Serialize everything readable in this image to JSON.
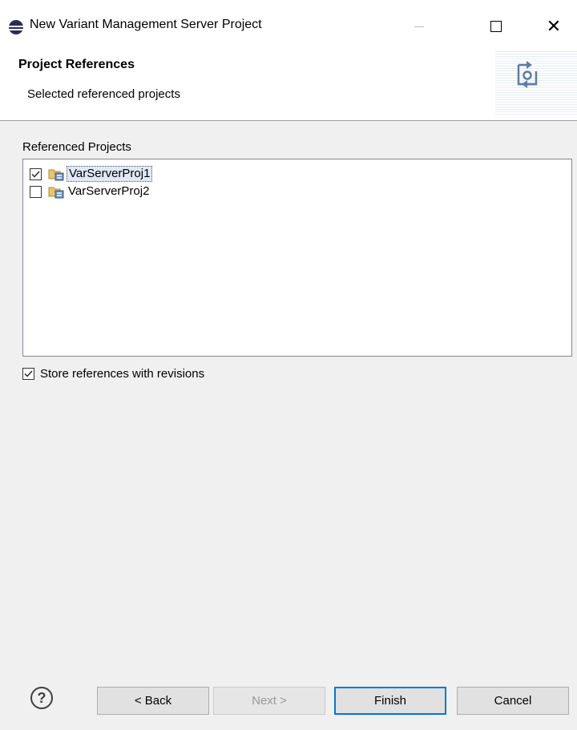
{
  "window": {
    "title": "New Variant Management Server Project",
    "minimize_icon": "minimize-icon",
    "maximize_icon": "maximize-icon",
    "close_glyph": "✕"
  },
  "banner": {
    "title": "Project References",
    "description": "Selected referenced projects",
    "icon": "wizard-banner-icon"
  },
  "referenced_projects": {
    "label": "Referenced Projects",
    "items": [
      {
        "label": "VarServerProj1",
        "checked": true,
        "focused": true,
        "icon": "server-project-icon"
      },
      {
        "label": "VarServerProj2",
        "checked": false,
        "focused": false,
        "icon": "server-project-icon"
      }
    ]
  },
  "options": {
    "store_references_label": "Store references with revisions",
    "store_references_checked": true
  },
  "buttons": {
    "help_glyph": "?",
    "back_label": "< Back",
    "next_label": "Next >",
    "next_enabled": false,
    "finish_label": "Finish",
    "cancel_label": "Cancel"
  },
  "colors": {
    "accent": "#0078d7",
    "dialog_bg": "#f0f0f0",
    "button_bg": "#e1e1e1",
    "disabled_text": "#9a9a9a"
  }
}
